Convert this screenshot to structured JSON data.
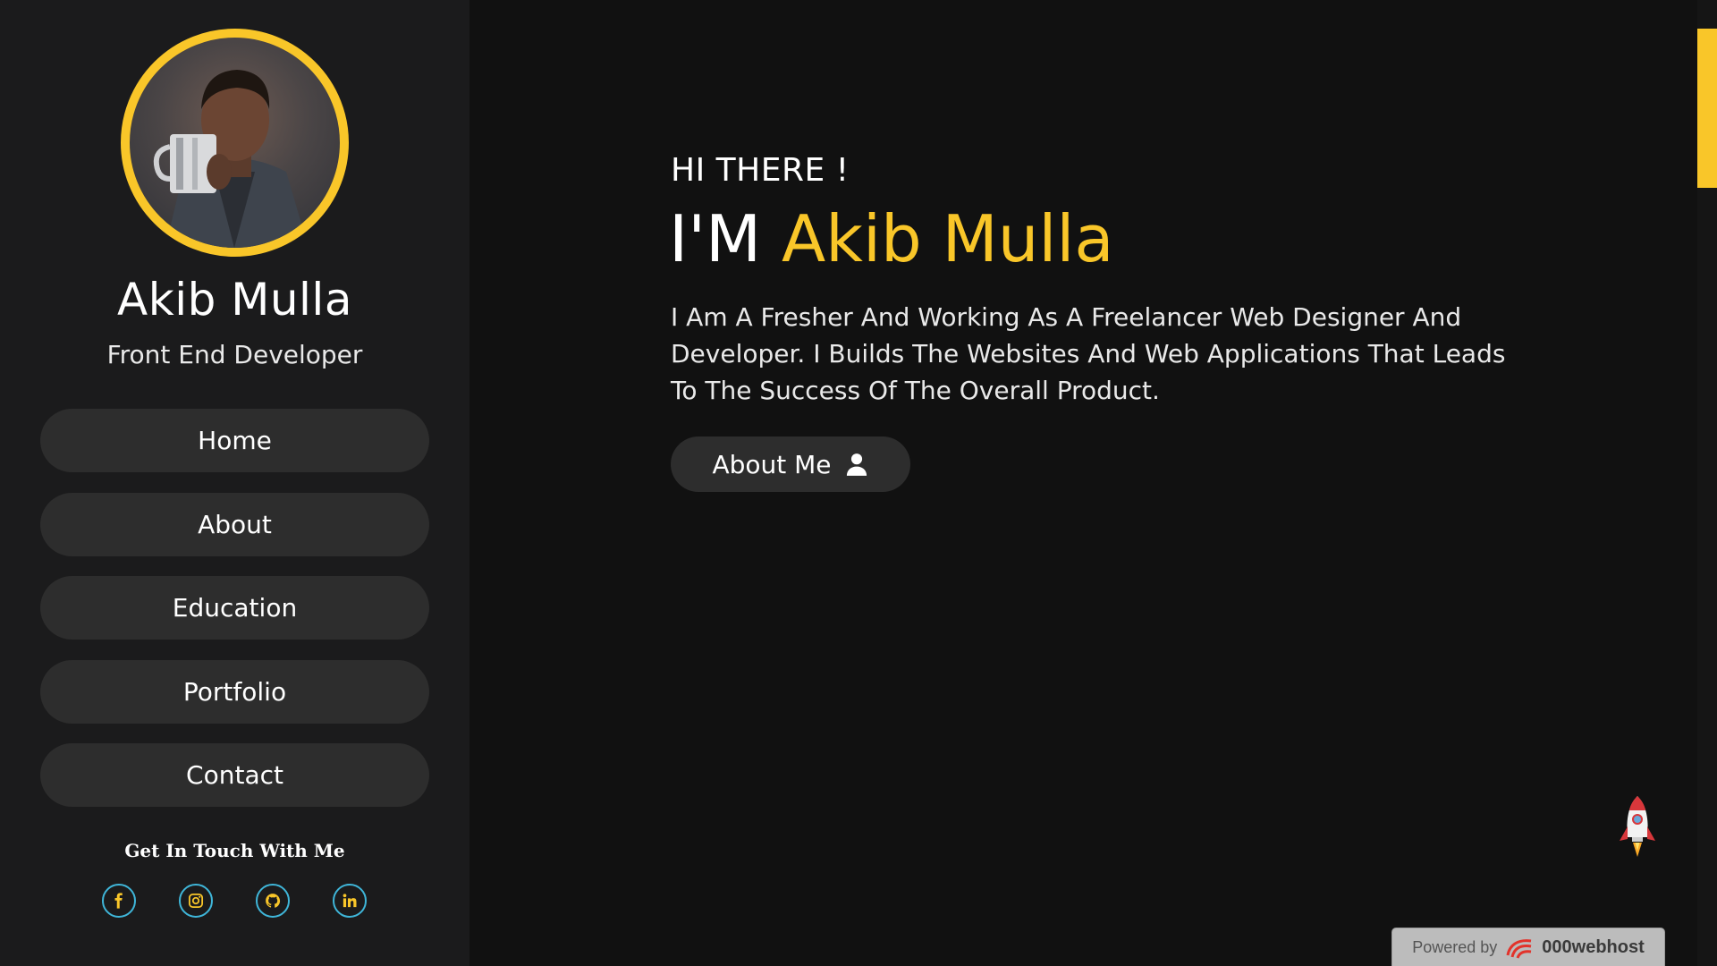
{
  "sidebar": {
    "profile_name": "Akib Mulla",
    "profile_role": "Front End Developer",
    "nav": [
      {
        "label": "Home"
      },
      {
        "label": "About"
      },
      {
        "label": "Education"
      },
      {
        "label": "Portfolio"
      },
      {
        "label": "Contact"
      }
    ],
    "touch_title": "Get In Touch With Me",
    "socials": [
      {
        "icon": "facebook-icon"
      },
      {
        "icon": "instagram-icon"
      },
      {
        "icon": "github-icon"
      },
      {
        "icon": "linkedin-icon"
      }
    ]
  },
  "main": {
    "greeting": "HI THERE !",
    "headline_prefix": "I'M",
    "headline_name": "Akib Mulla",
    "intro": "I Am A Fresher And Working As A Freelancer Web Designer And Developer. I Builds The Websites And Web Applications That Leads To The Success Of The Overall Product.",
    "about_button": "About Me",
    "about_button_icon": "user-icon"
  },
  "footer": {
    "powered_by": "Powered by",
    "brand": "000webhost"
  },
  "colors": {
    "accent": "#f9c629",
    "background": "#111111",
    "sidebar_bg": "#1b1b1c",
    "button_bg": "#2d2d2d",
    "social_ring": "#3fb6d9"
  }
}
